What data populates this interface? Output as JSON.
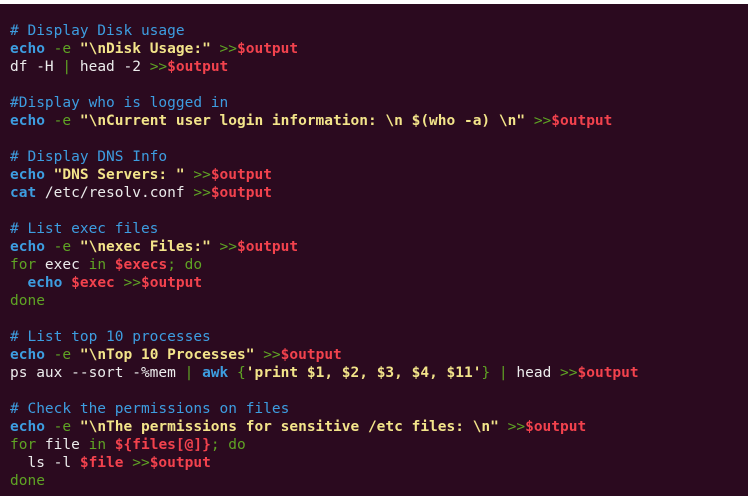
{
  "colors": {
    "background": "#2b0a1f",
    "comment": "#3d9de0",
    "keyword": "#3d9de0",
    "operator": "#5fa324",
    "string": "#f3e48a",
    "variable": "#f2424d",
    "plain": "#ececec"
  },
  "lines": [
    [
      {
        "t": "c",
        "v": "# Display Disk usage"
      }
    ],
    [
      {
        "t": "k",
        "v": "echo"
      },
      {
        "t": "p",
        "v": " "
      },
      {
        "t": "o",
        "v": "-e"
      },
      {
        "t": "p",
        "v": " "
      },
      {
        "t": "s",
        "v": "\"\\nDisk Usage:\""
      },
      {
        "t": "p",
        "v": " "
      },
      {
        "t": "o",
        "v": ">>"
      },
      {
        "t": "v",
        "v": "$output"
      }
    ],
    [
      {
        "t": "p",
        "v": "df -H "
      },
      {
        "t": "o",
        "v": "|"
      },
      {
        "t": "p",
        "v": " head -2 "
      },
      {
        "t": "o",
        "v": ">>"
      },
      {
        "t": "v",
        "v": "$output"
      }
    ],
    [],
    [
      {
        "t": "c",
        "v": "#Display who is logged in"
      }
    ],
    [
      {
        "t": "k",
        "v": "echo"
      },
      {
        "t": "p",
        "v": " "
      },
      {
        "t": "o",
        "v": "-e"
      },
      {
        "t": "p",
        "v": " "
      },
      {
        "t": "s",
        "v": "\"\\nCurrent user login information: \\n $(who -a) \\n\""
      },
      {
        "t": "p",
        "v": " "
      },
      {
        "t": "o",
        "v": ">>"
      },
      {
        "t": "v",
        "v": "$output"
      }
    ],
    [],
    [
      {
        "t": "c",
        "v": "# Display DNS Info"
      }
    ],
    [
      {
        "t": "k",
        "v": "echo"
      },
      {
        "t": "p",
        "v": " "
      },
      {
        "t": "s",
        "v": "\"DNS Servers: \""
      },
      {
        "t": "p",
        "v": " "
      },
      {
        "t": "o",
        "v": ">>"
      },
      {
        "t": "v",
        "v": "$output"
      }
    ],
    [
      {
        "t": "k",
        "v": "cat"
      },
      {
        "t": "p",
        "v": " /etc/resolv.conf "
      },
      {
        "t": "o",
        "v": ">>"
      },
      {
        "t": "v",
        "v": "$output"
      }
    ],
    [],
    [
      {
        "t": "c",
        "v": "# List exec files"
      }
    ],
    [
      {
        "t": "k",
        "v": "echo"
      },
      {
        "t": "p",
        "v": " "
      },
      {
        "t": "o",
        "v": "-e"
      },
      {
        "t": "p",
        "v": " "
      },
      {
        "t": "s",
        "v": "\"\\nexec Files:\""
      },
      {
        "t": "p",
        "v": " "
      },
      {
        "t": "o",
        "v": ">>"
      },
      {
        "t": "v",
        "v": "$output"
      }
    ],
    [
      {
        "t": "ctl",
        "v": "for"
      },
      {
        "t": "p",
        "v": " exec "
      },
      {
        "t": "ctl",
        "v": "in"
      },
      {
        "t": "p",
        "v": " "
      },
      {
        "t": "v",
        "v": "$execs"
      },
      {
        "t": "ctl",
        "v": "; do"
      }
    ],
    [
      {
        "t": "p",
        "v": "  "
      },
      {
        "t": "k",
        "v": "echo"
      },
      {
        "t": "p",
        "v": " "
      },
      {
        "t": "v",
        "v": "$exec"
      },
      {
        "t": "p",
        "v": " "
      },
      {
        "t": "o",
        "v": ">>"
      },
      {
        "t": "v",
        "v": "$output"
      }
    ],
    [
      {
        "t": "ctl",
        "v": "done"
      }
    ],
    [],
    [
      {
        "t": "c",
        "v": "# List top 10 processes"
      }
    ],
    [
      {
        "t": "k",
        "v": "echo"
      },
      {
        "t": "p",
        "v": " "
      },
      {
        "t": "o",
        "v": "-e"
      },
      {
        "t": "p",
        "v": " "
      },
      {
        "t": "s",
        "v": "\"\\nTop 10 Processes\""
      },
      {
        "t": "p",
        "v": " "
      },
      {
        "t": "o",
        "v": ">>"
      },
      {
        "t": "v",
        "v": "$output"
      }
    ],
    [
      {
        "t": "p",
        "v": "ps aux --sort -%mem "
      },
      {
        "t": "o",
        "v": "|"
      },
      {
        "t": "p",
        "v": " "
      },
      {
        "t": "k",
        "v": "awk"
      },
      {
        "t": "p",
        "v": " "
      },
      {
        "t": "o",
        "v": "{"
      },
      {
        "t": "s",
        "v": "'print $1, $2, $3, $4, $11'"
      },
      {
        "t": "o",
        "v": "}"
      },
      {
        "t": "p",
        "v": " "
      },
      {
        "t": "o",
        "v": "|"
      },
      {
        "t": "p",
        "v": " head "
      },
      {
        "t": "o",
        "v": ">>"
      },
      {
        "t": "v",
        "v": "$output"
      }
    ],
    [],
    [
      {
        "t": "c",
        "v": "# Check the permissions on files"
      }
    ],
    [
      {
        "t": "k",
        "v": "echo"
      },
      {
        "t": "p",
        "v": " "
      },
      {
        "t": "o",
        "v": "-e"
      },
      {
        "t": "p",
        "v": " "
      },
      {
        "t": "s",
        "v": "\"\\nThe permissions for sensitive /etc files: \\n\""
      },
      {
        "t": "p",
        "v": " "
      },
      {
        "t": "o",
        "v": ">>"
      },
      {
        "t": "v",
        "v": "$output"
      }
    ],
    [
      {
        "t": "ctl",
        "v": "for"
      },
      {
        "t": "p",
        "v": " file "
      },
      {
        "t": "ctl",
        "v": "in"
      },
      {
        "t": "p",
        "v": " "
      },
      {
        "t": "v",
        "v": "${files[@]}"
      },
      {
        "t": "ctl",
        "v": "; do"
      }
    ],
    [
      {
        "t": "p",
        "v": "  ls -l "
      },
      {
        "t": "v",
        "v": "$file"
      },
      {
        "t": "p",
        "v": " "
      },
      {
        "t": "o",
        "v": ">>"
      },
      {
        "t": "v",
        "v": "$output"
      }
    ],
    [
      {
        "t": "ctl",
        "v": "done"
      }
    ]
  ]
}
